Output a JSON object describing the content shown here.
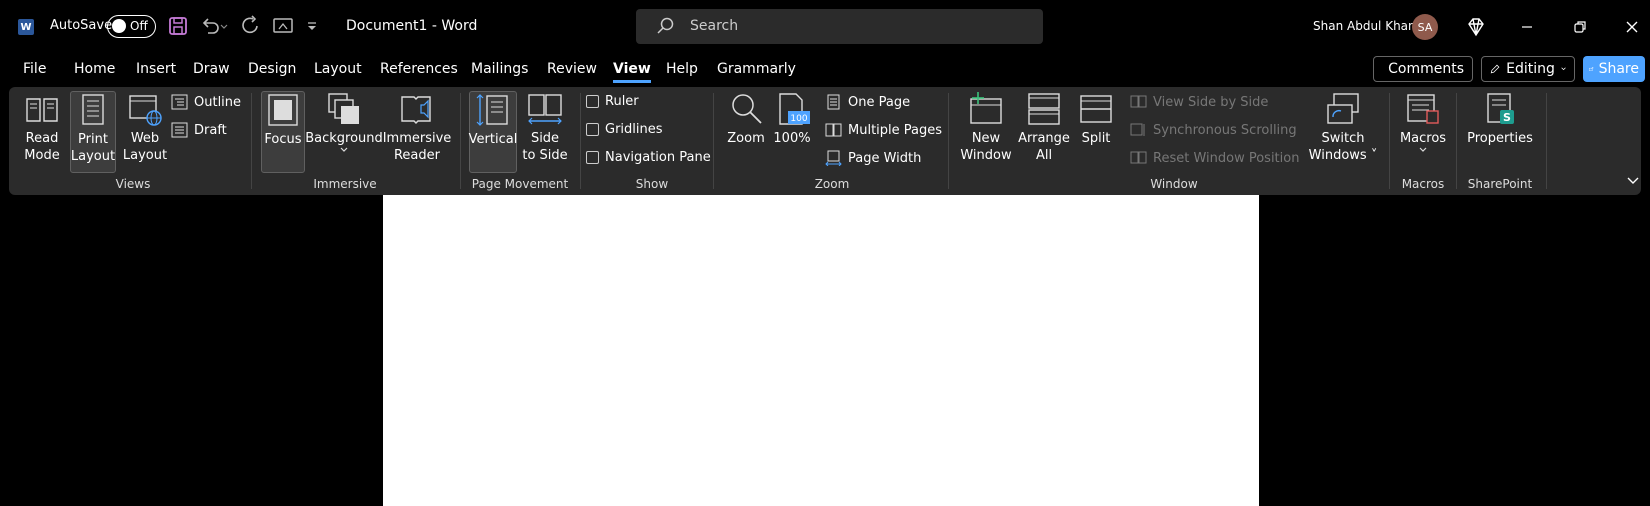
{
  "titlebar": {
    "app_logo": "W",
    "autosave_label": "AutoSave",
    "autosave_state": "Off",
    "document_title": "Document1  -  Word",
    "search_placeholder": "Search",
    "user_name": "Shan Abdul Khan",
    "avatar_initials": "SA"
  },
  "tabs": [
    "File",
    "Home",
    "Insert",
    "Draw",
    "Design",
    "Layout",
    "References",
    "Mailings",
    "Review",
    "View",
    "Help",
    "Grammarly"
  ],
  "active_tab": "View",
  "actions": {
    "comments": "Comments",
    "editing": "Editing",
    "share": "Share"
  },
  "ribbon": {
    "views": {
      "label": "Views",
      "read_mode": [
        "Read",
        "Mode"
      ],
      "print_layout": [
        "Print",
        "Layout"
      ],
      "web_layout": [
        "Web",
        "Layout"
      ],
      "outline": "Outline",
      "draft": "Draft"
    },
    "immersive": {
      "label": "Immersive",
      "focus": "Focus",
      "background": "Background",
      "immersive_reader": [
        "Immersive",
        "Reader"
      ]
    },
    "page_movement": {
      "label": "Page Movement",
      "vertical": "Vertical",
      "side_to_side": [
        "Side",
        "to Side"
      ]
    },
    "show": {
      "label": "Show",
      "ruler": "Ruler",
      "gridlines": "Gridlines",
      "navigation_pane": "Navigation Pane"
    },
    "zoom": {
      "label": "Zoom",
      "zoom": "Zoom",
      "hundred": "100%",
      "hundred_badge": "100",
      "one_page": "One Page",
      "multiple_pages": "Multiple Pages",
      "page_width": "Page Width"
    },
    "window": {
      "label": "Window",
      "new_window": [
        "New",
        "Window"
      ],
      "arrange_all": [
        "Arrange",
        "All"
      ],
      "split": "Split",
      "view_side_by_side": "View Side by Side",
      "synchronous_scrolling": "Synchronous Scrolling",
      "reset_window_position": "Reset Window Position",
      "switch_windows": [
        "Switch",
        "Windows"
      ]
    },
    "macros": {
      "label": "Macros",
      "macros": "Macros"
    },
    "sharepoint": {
      "label": "SharePoint",
      "properties": "Properties",
      "badge": "S"
    }
  },
  "colors": {
    "accent": "#4ea3ff",
    "ribbon_bg": "#2b2b2b",
    "word_blue": "#2b579a",
    "avatar_bg": "#8f5a4c"
  }
}
